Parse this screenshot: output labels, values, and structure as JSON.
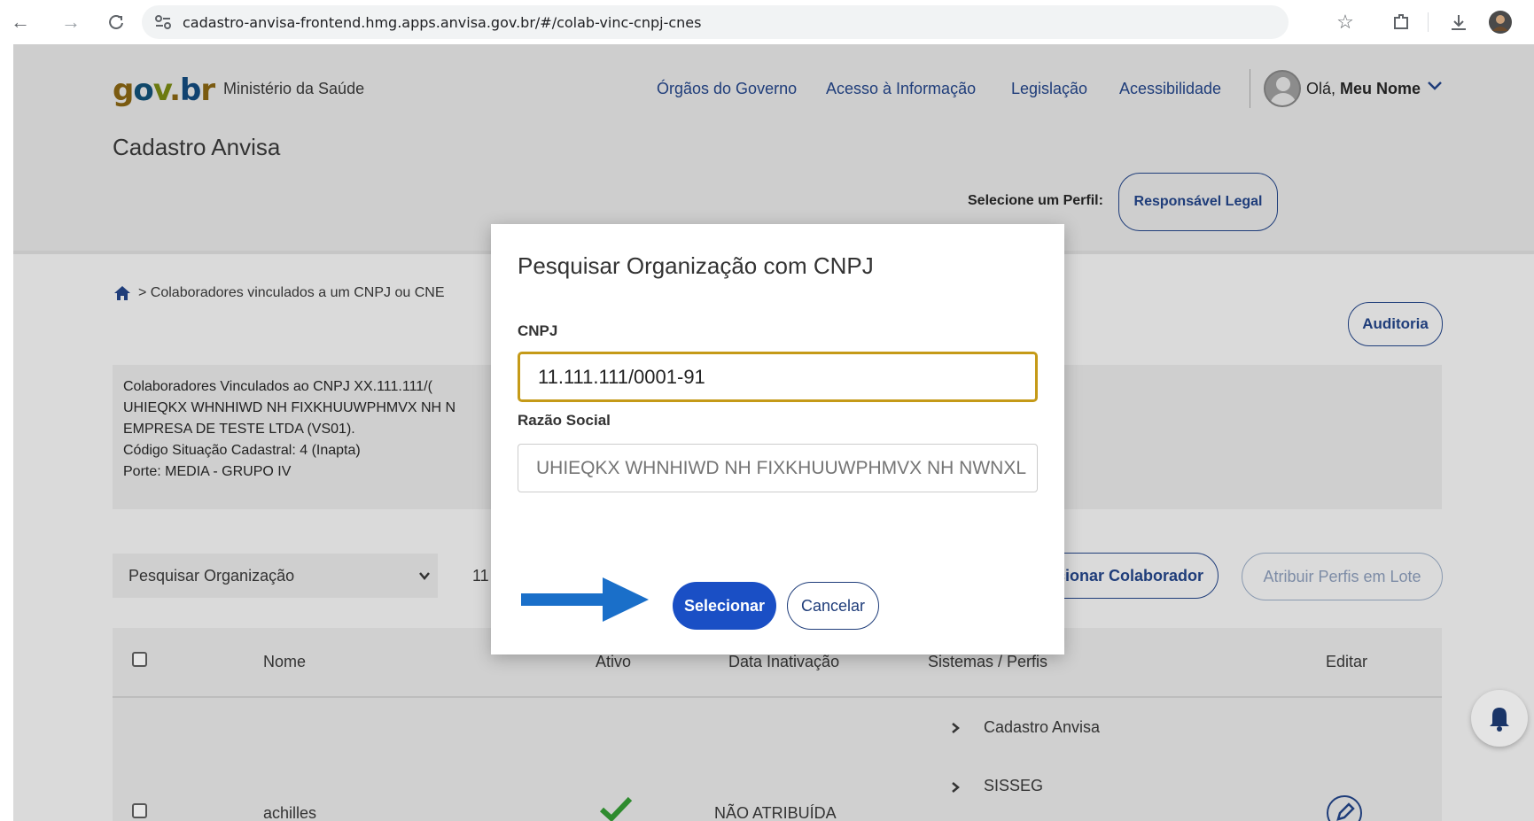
{
  "browser": {
    "url": "cadastro-anvisa-frontend.hmg.apps.anvisa.gov.br/#/colab-vinc-cnpj-cnes"
  },
  "header": {
    "logo": {
      "g": "g",
      "o": "o",
      "v": "v",
      "dot": ".",
      "b": "b",
      "r": "r"
    },
    "ministry": "Ministério da Saúde",
    "links": [
      "Órgãos do Governo",
      "Acesso à Informação",
      "Legislação",
      "Acessibilidade"
    ],
    "greeting_prefix": "Olá,",
    "user_name": "Meu Nome",
    "app_title": "Cadastro Anvisa",
    "profile_label": "Selecione um Perfil:",
    "profile_value": "Responsável Legal"
  },
  "breadcrumb": {
    "text": "> Colaboradores vinculados a um CNPJ ou CNE"
  },
  "audit_button": "Auditoria",
  "info": {
    "lines": [
      "Colaboradores Vinculados ao CNPJ XX.111.111/(",
      "UHIEQKX WHNHIWD NH FIXKHUUWPHMVX NH N",
      "EMPRESA DE TESTE LTDA (VS01).",
      "Código Situação Cadastral: 4 (Inapta)",
      "Porte: MEDIA - GRUPO IV"
    ]
  },
  "toolbar": {
    "org_select": "Pesquisar Organização",
    "org_value": "11",
    "add_collaborator": "cionar Colaborador",
    "batch_profiles": "Atribuir Perfis em Lote"
  },
  "table": {
    "headers": {
      "name": "Nome",
      "active": "Ativo",
      "inactivation": "Data Inativação",
      "systems": "Sistemas / Perfis",
      "edit": "Editar"
    },
    "systems": [
      "Cadastro Anvisa",
      "SISSEG"
    ],
    "row": {
      "name": "achilles",
      "inactivation": "NÃO ATRIBUÍDA"
    }
  },
  "modal": {
    "title": "Pesquisar Organização com CNPJ",
    "cnpj_label": "CNPJ",
    "cnpj_value": "11.111.111/0001-91",
    "razao_label": "Razão Social",
    "razao_placeholder": "UHIEQKX WHNHIWD NH FIXKHUUWPHMVX NH NWNXL",
    "select_button": "Selecionar",
    "cancel_button": "Cancelar"
  },
  "colors": {
    "primary": "#1a4fc5",
    "link": "#1f3d7a",
    "focus_border": "#c59a18",
    "arrow": "#1a6fc9",
    "check": "#2e8b2e"
  }
}
